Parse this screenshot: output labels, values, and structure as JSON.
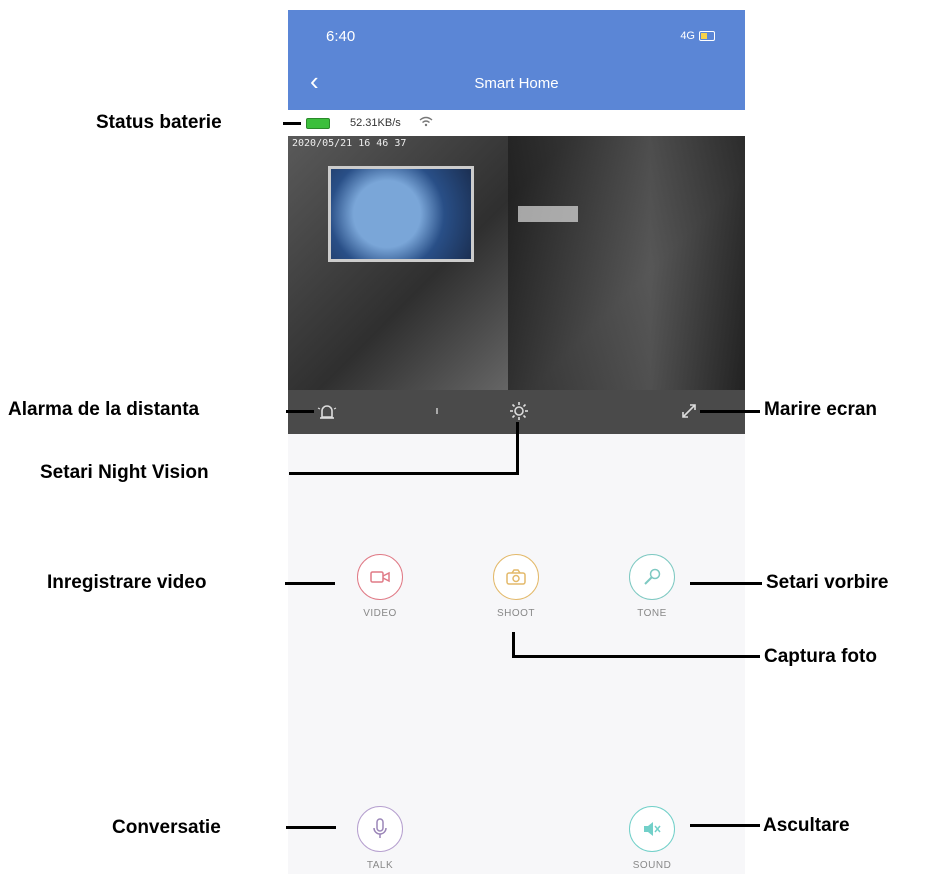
{
  "phone": {
    "time": "6:40",
    "signal": "4G",
    "back_icon": "chevron-left-icon",
    "title": "Smart Home",
    "speed": "52.31KB/s",
    "timestamp": "2020/05/21 16 46 37",
    "controls": {
      "alarm_icon": "siren-icon",
      "night_icon": "sun-gear-icon",
      "fullscreen_icon": "expand-icon"
    },
    "buttons": {
      "video": "VIDEO",
      "shoot": "SHOOT",
      "tone": "TONE",
      "talk": "TALK",
      "sound": "SOUND"
    },
    "colors": {
      "header": "#5b86d6",
      "video_btn": "#e07a86",
      "shoot_btn": "#e3b96a",
      "tone_btn": "#7ec9c2",
      "talk_btn": "#b6a0cf",
      "sound_btn": "#72d0c9"
    }
  },
  "callouts": {
    "battery_status": "Status baterie",
    "remote_alarm": "Alarma de la distanta",
    "night_vision": "Setari Night Vision",
    "fullscreen": "Marire ecran",
    "record_video": "Inregistrare video",
    "speech_settings": "Setari vorbire",
    "photo_capture": "Captura foto",
    "conversation": "Conversatie",
    "listening": "Ascultare"
  }
}
